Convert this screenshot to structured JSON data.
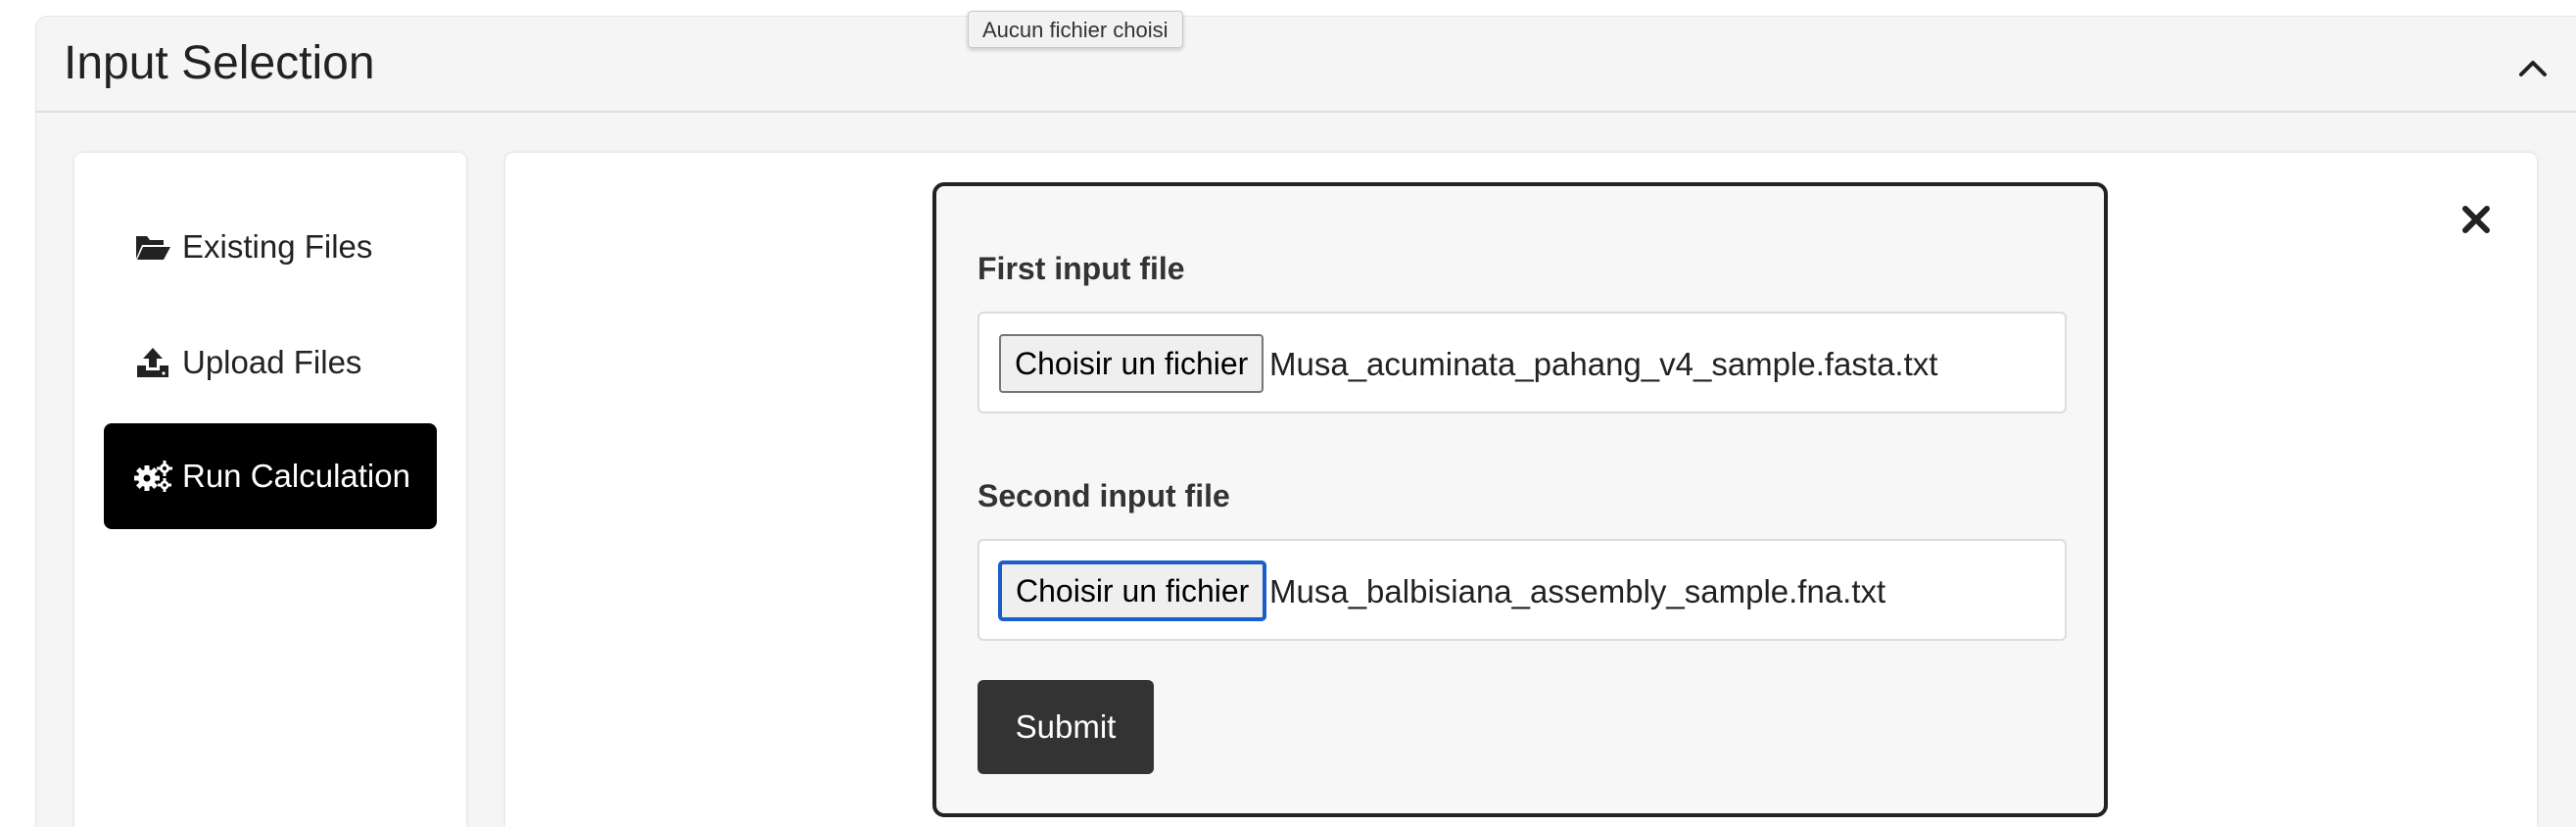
{
  "header": {
    "title": "Input Selection",
    "collapse_icon": "chevron-up-icon"
  },
  "tooltip": {
    "text": "Aucun fichier choisi"
  },
  "sidebar": {
    "items": [
      {
        "label": "Existing Files",
        "icon": "folder-open-icon",
        "active": false
      },
      {
        "label": "Upload Files",
        "icon": "upload-icon",
        "active": false
      },
      {
        "label": "Run Calculation",
        "icon": "cogs-icon",
        "active": true
      }
    ]
  },
  "form": {
    "first": {
      "label": "First input file",
      "button_label": "Choisir un fichier",
      "file_name": "Musa_acuminata_pahang_v4_sample.fasta.txt"
    },
    "second": {
      "label": "Second input file",
      "button_label": "Choisir un fichier",
      "file_name": "Musa_balbisiana_assembly_sample.fna.txt"
    },
    "submit_label": "Submit",
    "close_icon": "close-icon"
  },
  "colors": {
    "active_nav_bg": "#000000",
    "submit_bg": "#333333",
    "focus_ring": "#1a5fc9"
  }
}
